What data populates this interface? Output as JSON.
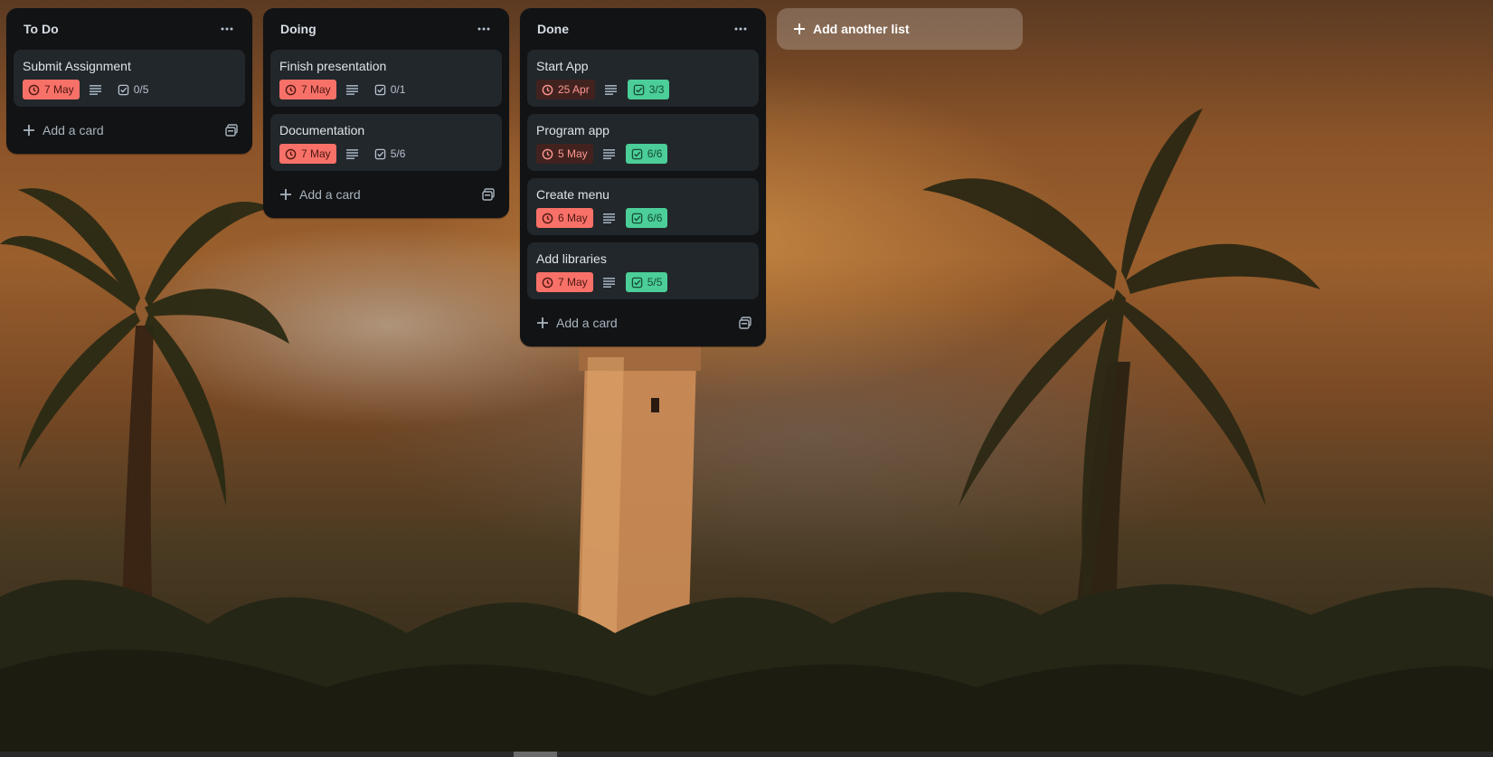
{
  "colors": {
    "list_bg": "#111315",
    "card_bg": "#22272b",
    "due_overdue": "#f87168",
    "due_dark": "#42221f",
    "checklist_complete": "#4bce97"
  },
  "lists": [
    {
      "title": "To Do",
      "menu_icon": "ellipsis-icon",
      "cards": [
        {
          "title": "Submit Assignment",
          "due": "7 May",
          "checklist": "0/5",
          "due_style": "overdue",
          "checklist_complete": false
        }
      ],
      "add_card_label": "Add a card"
    },
    {
      "title": "Doing",
      "menu_icon": "ellipsis-icon",
      "cards": [
        {
          "title": "Finish presentation",
          "due": "7 May",
          "checklist": "0/1",
          "due_style": "overdue",
          "checklist_complete": false
        },
        {
          "title": "Documentation",
          "due": "7 May",
          "checklist": "5/6",
          "due_style": "overdue",
          "checklist_complete": false
        }
      ],
      "add_card_label": "Add a card"
    },
    {
      "title": "Done",
      "menu_icon": "ellipsis-icon",
      "cards": [
        {
          "title": "Start App",
          "due": "25 Apr",
          "checklist": "3/3",
          "due_style": "dark",
          "checklist_complete": true
        },
        {
          "title": "Program app",
          "due": "5 May",
          "checklist": "6/6",
          "due_style": "dark",
          "checklist_complete": true
        },
        {
          "title": "Create menu",
          "due": "6 May",
          "checklist": "6/6",
          "due_style": "overdue",
          "checklist_complete": true
        },
        {
          "title": "Add libraries",
          "due": "7 May",
          "checklist": "5/5",
          "due_style": "overdue",
          "checklist_complete": true
        }
      ],
      "add_card_label": "Add a card"
    }
  ],
  "add_list_label": "Add another list"
}
